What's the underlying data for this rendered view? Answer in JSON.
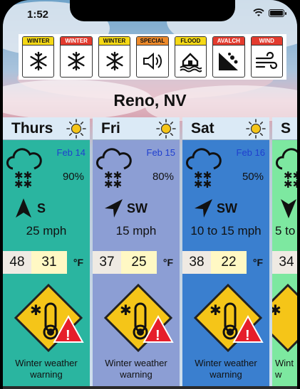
{
  "status_bar": {
    "time": "1:52"
  },
  "alerts": [
    {
      "label": "WINTER",
      "label_bg": "#f5d816",
      "label_color": "#111111",
      "icon": "snowflake-icon"
    },
    {
      "label": "WINTER",
      "label_bg": "#e33b2e",
      "label_color": "#ffffff",
      "icon": "snowflake-icon"
    },
    {
      "label": "WINTER",
      "label_bg": "#f5d816",
      "label_color": "#111111",
      "icon": "snowflake-icon"
    },
    {
      "label": "SPECIAL",
      "label_bg": "#ee8a2a",
      "label_color": "#111111",
      "icon": "speaker-icon"
    },
    {
      "label": "FLOOD",
      "label_bg": "#f5d816",
      "label_color": "#111111",
      "icon": "flood-house-icon"
    },
    {
      "label": "AVALCH",
      "label_bg": "#e33b2e",
      "label_color": "#ffffff",
      "icon": "avalanche-icon"
    },
    {
      "label": "WIND",
      "label_bg": "#e33b2e",
      "label_color": "#ffffff",
      "icon": "wind-icon"
    }
  ],
  "location": {
    "city": "Reno, NV"
  },
  "days": [
    {
      "name": "Thurs",
      "date": "Feb 14",
      "precip": "90%",
      "wind_dir": "S",
      "wind_speed": "25 mph",
      "high": "48",
      "low": "31",
      "unit": "°F",
      "warning_line1": "Winter weather",
      "warning_line2": "warning",
      "bg": "#2ab5a0"
    },
    {
      "name": "Fri",
      "date": "Feb 15",
      "precip": "80%",
      "wind_dir": "SW",
      "wind_speed": "15 mph",
      "high": "37",
      "low": "25",
      "unit": "°F",
      "warning_line1": "Winter weather",
      "warning_line2": "warning",
      "bg": "#8c9ed4"
    },
    {
      "name": "Sat",
      "date": "Feb 16",
      "precip": "50%",
      "wind_dir": "SW",
      "wind_speed": "10 to 15 mph",
      "high": "38",
      "low": "22",
      "unit": "°F",
      "warning_line1": "Winter weather",
      "warning_line2": "warning",
      "bg": "#3a7fcf"
    },
    {
      "name": "S",
      "wind_speed": "5 to",
      "high": "34",
      "warning_line1": "Wint",
      "warning_line2": "w",
      "bg": "#7de8a0"
    }
  ]
}
